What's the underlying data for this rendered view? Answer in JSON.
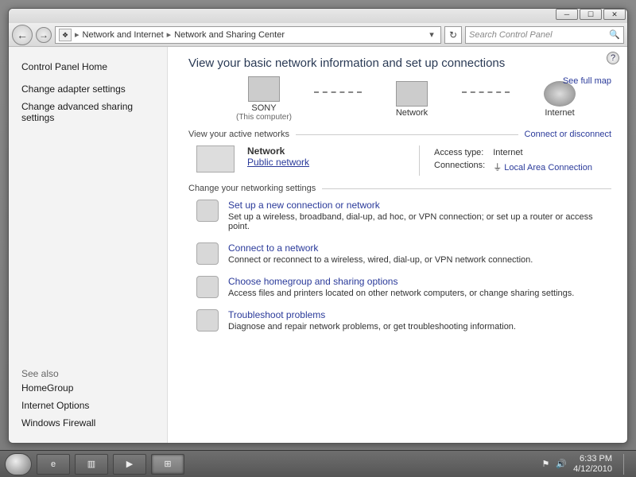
{
  "window": {
    "min_glyph": "─",
    "max_glyph": "☐",
    "close_glyph": "✕"
  },
  "addressbar": {
    "back_glyph": "←",
    "fwd_glyph": "→",
    "crumb_icon": "❖",
    "crumb1": "Network and Internet",
    "crumb2": "Network and Sharing Center",
    "refresh_glyph": "↻",
    "search_placeholder": "Search Control Panel",
    "search_icon": "🔍"
  },
  "sidebar": {
    "home": "Control Panel Home",
    "links": [
      "Change adapter settings",
      "Change advanced sharing settings"
    ],
    "seealso_label": "See also",
    "seealso": [
      "HomeGroup",
      "Internet Options",
      "Windows Firewall"
    ]
  },
  "main": {
    "help_glyph": "?",
    "title": "View your basic network information and set up connections",
    "map": {
      "node1": "SONY",
      "node1_sub": "(This computer)",
      "node2": "Network",
      "node3": "Internet",
      "full_map": "See full map"
    },
    "active_header": "View your active networks",
    "connect_link": "Connect or disconnect",
    "network": {
      "name": "Network",
      "type": "Public network",
      "access_label": "Access type:",
      "access_value": "Internet",
      "conn_label": "Connections:",
      "conn_value": "Local Area Connection"
    },
    "change_header": "Change your networking settings",
    "tasks": [
      {
        "title": "Set up a new connection or network",
        "desc": "Set up a wireless, broadband, dial-up, ad hoc, or VPN connection; or set up a router or access point."
      },
      {
        "title": "Connect to a network",
        "desc": "Connect or reconnect to a wireless, wired, dial-up, or VPN network connection."
      },
      {
        "title": "Choose homegroup and sharing options",
        "desc": "Access files and printers located on other network computers, or change sharing settings."
      },
      {
        "title": "Troubleshoot problems",
        "desc": "Diagnose and repair network problems, or get troubleshooting information."
      }
    ]
  },
  "taskbar": {
    "ie_glyph": "e",
    "explorer_glyph": "▥",
    "wmp_glyph": "▶",
    "cp_glyph": "⊞",
    "vol_glyph": "🔊",
    "flag_glyph": "⚑",
    "time": "6:33 PM",
    "date": "4/12/2010"
  }
}
